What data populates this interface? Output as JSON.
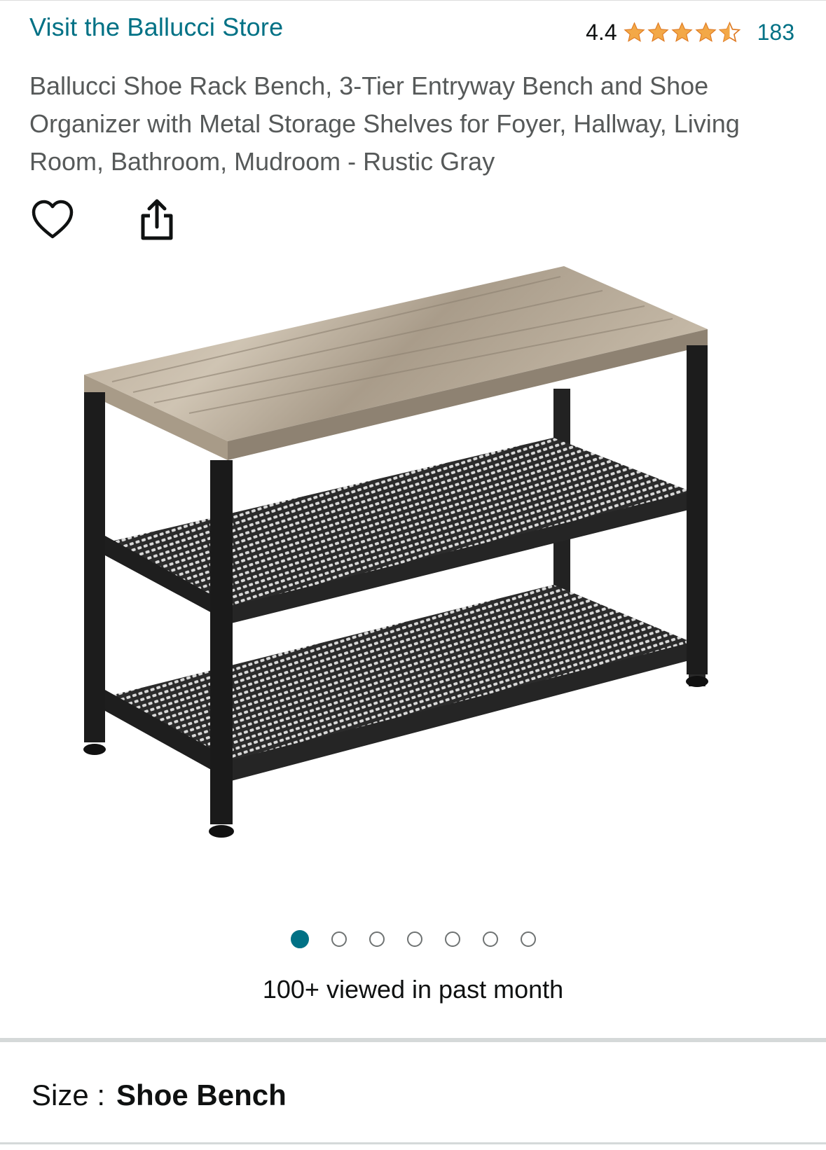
{
  "store": {
    "link_label": "Visit the Ballucci Store"
  },
  "rating": {
    "score": "4.4",
    "stars": 4.4,
    "count": "183",
    "star_color": "#f3a847"
  },
  "product": {
    "title": "Ballucci Shoe Rack Bench, 3-Tier Entryway Bench and Shoe Organizer with Metal Storage Shelves for Foyer, Hallway, Living Room, Bathroom, Mudroom - Rustic Gray",
    "image_name": "shoe-rack-bench-image"
  },
  "actions": {
    "wishlist_icon": "heart-icon",
    "share_icon": "share-icon"
  },
  "carousel": {
    "total": 7,
    "active_index": 0,
    "active_color": "#007185"
  },
  "social_proof": {
    "text": "100+ viewed in past month"
  },
  "size": {
    "label": "Size :",
    "value": "Shoe Bench"
  },
  "colors": {
    "link": "#007185",
    "text": "#0f1111",
    "muted": "#565959"
  }
}
